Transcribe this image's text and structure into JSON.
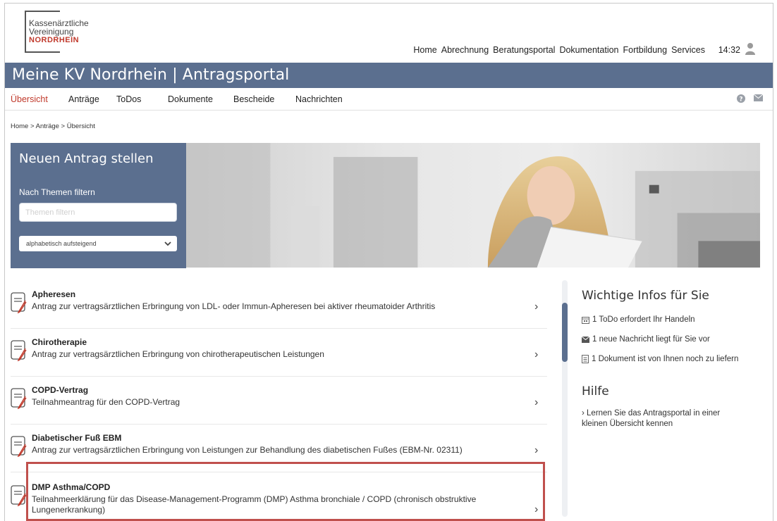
{
  "logo": {
    "line1": "Kassenärztliche",
    "line2": "Vereinigung",
    "line3": "NORDRHEIN"
  },
  "topnav": {
    "items": [
      "Home",
      "Abrechnung",
      "Beratungsportal",
      "Dokumentation",
      "Fortbildung",
      "Services"
    ],
    "time": "14:32"
  },
  "title": "Meine KV Nordrhein | Antragsportal",
  "subnav": {
    "items": [
      "Übersicht",
      "Anträge",
      "ToDos",
      "Dokumente",
      "Bescheide",
      "Nachrichten"
    ],
    "active": "Übersicht"
  },
  "breadcrumb": "Home > Anträge > Übersicht",
  "hero": {
    "title": "Neuen Antrag stellen",
    "filter_label": "Nach Themen filtern",
    "filter_placeholder": "Themen filtern",
    "sort_value": "alphabetisch aufsteigend"
  },
  "list": [
    {
      "title": "Apheresen",
      "desc": "Antrag zur vertragsärztlichen Erbringung von LDL- oder Immun-Apheresen bei aktiver rheumatoider Arthritis"
    },
    {
      "title": "Chirotherapie",
      "desc": "Antrag zur vertragsärztlichen Erbringung von chirotherapeutischen Leistungen"
    },
    {
      "title": "COPD-Vertrag",
      "desc": "Teilnahmeantrag für den COPD-Vertrag"
    },
    {
      "title": "Diabetischer Fuß EBM",
      "desc": "Antrag zur vertragsärztlichen Erbringung von Leistungen zur Behandlung des diabetischen Fußes (EBM-Nr. 02311)"
    },
    {
      "title": "DMP Asthma/COPD",
      "desc": "Teilnahmeerklärung für das Disease-Management-Programm (DMP) Asthma bronchiale / COPD (chronisch obstruktive Lungenerkrankung)"
    }
  ],
  "sidebar": {
    "heading": "Wichtige Infos für Sie",
    "infos": [
      "1 ToDo erfordert Ihr Handeln",
      "1 neue Nachricht liegt für Sie vor",
      "1 Dokument ist von Ihnen noch zu liefern"
    ],
    "help_heading": "Hilfe",
    "help_link": "› Lernen Sie das Antragsportal in einer kleinen Übersicht kennen"
  },
  "colors": {
    "brand_blue": "#5b6f8f",
    "brand_red": "#c0392b",
    "highlight": "#c0504d"
  }
}
